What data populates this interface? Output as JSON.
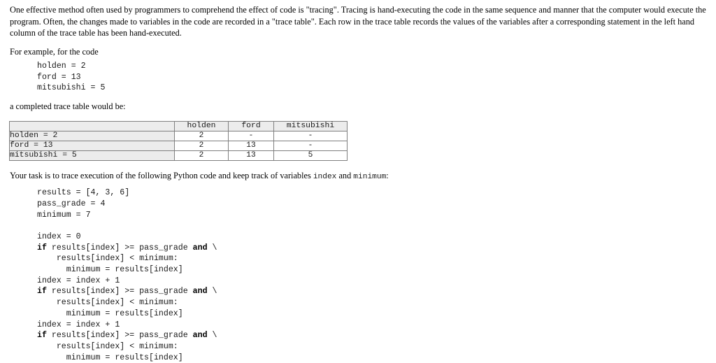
{
  "document": {
    "intro_paragraph": "One effective method often used by programmers to comprehend the effect of code is \"tracing\".  Tracing is hand-executing the code in the same sequence and manner that the computer would execute the program.  Often, the changes made to variables in the code are recorded in a \"trace table\".  Each row in the trace table records the values of the variables after a corresponding statement in the left hand column of the trace table has been hand-executed.",
    "example_lead": "For example, for the code",
    "example_code": "holden = 2\nford = 13\nmitsubishi = 5",
    "table_lead": "a completed trace table would be:",
    "task_text_before": "Your task is to trace execution of the following Python code and keep track of variables ",
    "task_var_1": "index",
    "task_text_middle": " and ",
    "task_var_2": "minimum",
    "task_text_after": ":"
  },
  "trace_table": {
    "columns": [
      "",
      "holden",
      "ford",
      "mitsubishi"
    ],
    "rows": [
      {
        "statement": "holden = 2",
        "values": [
          "2",
          "-",
          "-"
        ]
      },
      {
        "statement": "ford = 13",
        "values": [
          "2",
          "13",
          "-"
        ]
      },
      {
        "statement": "mitsubishi = 5",
        "values": [
          "2",
          "13",
          "5"
        ]
      }
    ]
  },
  "python_code": {
    "lines": [
      {
        "segments": [
          {
            "text": "results = [4, 3, 6]",
            "bold": false
          }
        ]
      },
      {
        "segments": [
          {
            "text": "pass_grade = 4",
            "bold": false
          }
        ]
      },
      {
        "segments": [
          {
            "text": "minimum = 7",
            "bold": false
          }
        ]
      },
      {
        "segments": [
          {
            "text": "",
            "bold": false
          }
        ]
      },
      {
        "segments": [
          {
            "text": "index = 0",
            "bold": false
          }
        ]
      },
      {
        "segments": [
          {
            "text": "if",
            "bold": true
          },
          {
            "text": " results[index] >= pass_grade ",
            "bold": false
          },
          {
            "text": "and",
            "bold": true
          },
          {
            "text": " \\",
            "bold": false
          }
        ]
      },
      {
        "segments": [
          {
            "text": "    results[index] < minimum:",
            "bold": false
          }
        ]
      },
      {
        "segments": [
          {
            "text": "      minimum = results[index]",
            "bold": false
          }
        ]
      },
      {
        "segments": [
          {
            "text": "index = index + 1",
            "bold": false
          }
        ]
      },
      {
        "segments": [
          {
            "text": "if",
            "bold": true
          },
          {
            "text": " results[index] >= pass_grade ",
            "bold": false
          },
          {
            "text": "and",
            "bold": true
          },
          {
            "text": " \\",
            "bold": false
          }
        ]
      },
      {
        "segments": [
          {
            "text": "    results[index] < minimum:",
            "bold": false
          }
        ]
      },
      {
        "segments": [
          {
            "text": "      minimum = results[index]",
            "bold": false
          }
        ]
      },
      {
        "segments": [
          {
            "text": "index = index + 1",
            "bold": false
          }
        ]
      },
      {
        "segments": [
          {
            "text": "if",
            "bold": true
          },
          {
            "text": " results[index] >= pass_grade ",
            "bold": false
          },
          {
            "text": "and",
            "bold": true
          },
          {
            "text": " \\",
            "bold": false
          }
        ]
      },
      {
        "segments": [
          {
            "text": "    results[index] < minimum:",
            "bold": false
          }
        ]
      },
      {
        "segments": [
          {
            "text": "      minimum = results[index]",
            "bold": false
          }
        ]
      }
    ]
  },
  "colors": {
    "header_bg": "#ececec",
    "cell_bg": "#ffffff",
    "border": "#808080",
    "text": "#000000"
  }
}
